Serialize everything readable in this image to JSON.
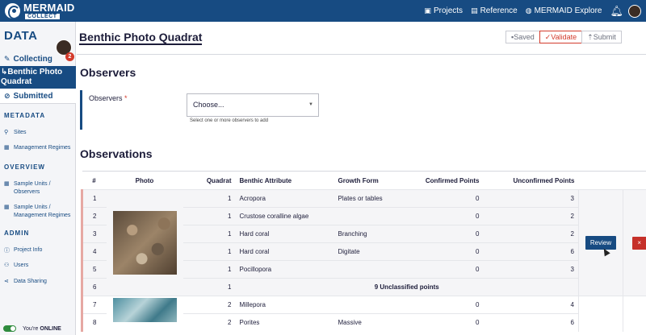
{
  "topbar": {
    "logo_title": "MERMAID",
    "logo_sub": "COLLECT",
    "nav": [
      {
        "icon": "projects-icon",
        "label": "Projects"
      },
      {
        "icon": "reference-icon",
        "label": "Reference"
      },
      {
        "icon": "globe-icon",
        "label": "MERMAID Explore"
      }
    ]
  },
  "sidebar": {
    "heading": "DATA",
    "badge": "2",
    "collecting": "Collecting",
    "active_line1": "↳Benthic Photo",
    "active_line2": "Quadrat",
    "submitted": "Submitted",
    "metadata_title": "METADATA",
    "sites": "Sites",
    "management_regimes": "Management Regimes",
    "overview_title": "OVERVIEW",
    "su_observers_1": "Sample Units /",
    "su_observers_2": "Observers",
    "su_mr_1": "Sample Units /",
    "su_mr_2": "Management Regimes",
    "admin_title": "ADMIN",
    "project_info": "Project Info",
    "users": "Users",
    "data_sharing": "Data Sharing",
    "online_prefix": "You're",
    "online_status": "ONLINE"
  },
  "main": {
    "page_title": "Benthic Photo Quadrat",
    "steps": {
      "saved": "Saved",
      "validate": "Validate",
      "submit": "Submit"
    },
    "observers_section": "Observers",
    "observers_label": "Observers",
    "observers_required": "*",
    "observers_placeholder": "Choose...",
    "observers_help": "Select one or more observers to add",
    "observations_section": "Observations",
    "review_label": "Review",
    "delete_label": "×"
  },
  "table": {
    "headers": [
      "#",
      "Photo",
      "Quadrat",
      "Benthic Attribute",
      "Growth Form",
      "Confirmed Points",
      "Unconfirmed Points"
    ],
    "rows": [
      {
        "idx": "1",
        "quadrat": "1",
        "attribute": "Acropora",
        "growth": "Plates or tables",
        "confirmed": "0",
        "unconfirmed": "3"
      },
      {
        "idx": "2",
        "quadrat": "1",
        "attribute": "Crustose coralline algae",
        "growth": "",
        "confirmed": "0",
        "unconfirmed": "2"
      },
      {
        "idx": "3",
        "quadrat": "1",
        "attribute": "Hard coral",
        "growth": "Branching",
        "confirmed": "0",
        "unconfirmed": "2"
      },
      {
        "idx": "4",
        "quadrat": "1",
        "attribute": "Hard coral",
        "growth": "Digitate",
        "confirmed": "0",
        "unconfirmed": "6"
      },
      {
        "idx": "5",
        "quadrat": "1",
        "attribute": "Pocillopora",
        "growth": "",
        "confirmed": "0",
        "unconfirmed": "3"
      },
      {
        "idx": "6",
        "quadrat": "1",
        "unclassified": "9 Unclassified points"
      },
      {
        "idx": "7",
        "quadrat": "2",
        "attribute": "Millepora",
        "growth": "",
        "confirmed": "0",
        "unconfirmed": "4"
      },
      {
        "idx": "8",
        "quadrat": "2",
        "attribute": "Porites",
        "growth": "Massive",
        "confirmed": "0",
        "unconfirmed": "6"
      }
    ]
  }
}
